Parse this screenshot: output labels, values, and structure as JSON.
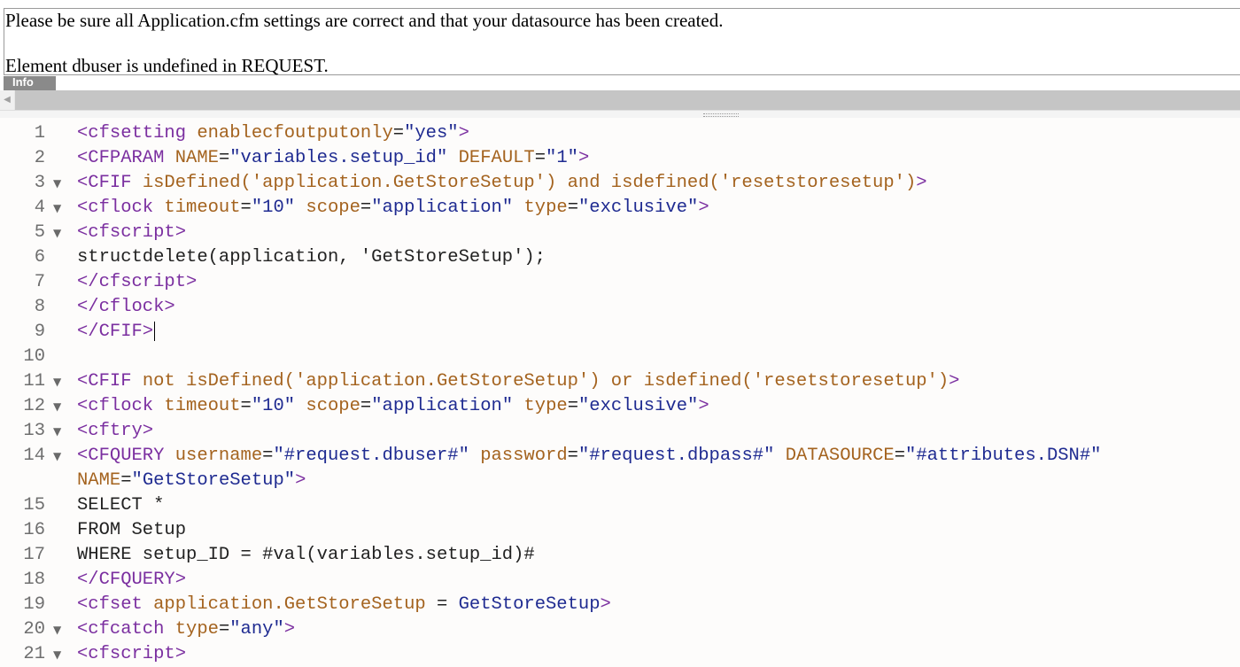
{
  "error": {
    "line1": "Please be sure all Application.cfm settings are correct and that your datasource has been created.",
    "line2": "Element dbuser is undefined in REQUEST."
  },
  "tab_stub": "Info",
  "scrollbar": {
    "left_arrow": "◀"
  },
  "editor": {
    "lines": [
      {
        "num": "1",
        "fold": false,
        "tokens": [
          [
            "tag",
            "<cfsetting "
          ],
          [
            "attr",
            "enablecfoutputonly"
          ],
          [
            "plain",
            "="
          ],
          [
            "str",
            "\"yes\""
          ],
          [
            "tag",
            ">"
          ]
        ]
      },
      {
        "num": "2",
        "fold": false,
        "tokens": [
          [
            "tag",
            "<CFPARAM "
          ],
          [
            "attr",
            "NAME"
          ],
          [
            "plain",
            "="
          ],
          [
            "str",
            "\"variables.setup_id\""
          ],
          [
            "plain",
            " "
          ],
          [
            "attr",
            "DEFAULT"
          ],
          [
            "plain",
            "="
          ],
          [
            "str",
            "\"1\""
          ],
          [
            "tag",
            ">"
          ]
        ]
      },
      {
        "num": "3",
        "fold": true,
        "tokens": [
          [
            "tag",
            "<CFIF "
          ],
          [
            "attr",
            "isDefined('application.GetStoreSetup') and isdefined('resetstoresetup')"
          ],
          [
            "tag",
            ">"
          ]
        ]
      },
      {
        "num": "4",
        "fold": true,
        "tokens": [
          [
            "tag",
            "<cflock "
          ],
          [
            "attr",
            "timeout"
          ],
          [
            "plain",
            "="
          ],
          [
            "str",
            "\"10\""
          ],
          [
            "plain",
            " "
          ],
          [
            "attr",
            "scope"
          ],
          [
            "plain",
            "="
          ],
          [
            "str",
            "\"application\""
          ],
          [
            "plain",
            " "
          ],
          [
            "attr",
            "type"
          ],
          [
            "plain",
            "="
          ],
          [
            "str",
            "\"exclusive\""
          ],
          [
            "tag",
            ">"
          ]
        ]
      },
      {
        "num": "5",
        "fold": true,
        "tokens": [
          [
            "tag",
            "<cfscript>"
          ]
        ]
      },
      {
        "num": "6",
        "fold": false,
        "tokens": [
          [
            "plain",
            "structdelete(application, 'GetStoreSetup');"
          ]
        ]
      },
      {
        "num": "7",
        "fold": false,
        "tokens": [
          [
            "tag",
            "</cfscript>"
          ]
        ]
      },
      {
        "num": "8",
        "fold": false,
        "tokens": [
          [
            "tag",
            "</cflock>"
          ]
        ]
      },
      {
        "num": "9",
        "fold": false,
        "caret": true,
        "tokens": [
          [
            "tag",
            "</CFIF>"
          ]
        ]
      },
      {
        "num": "10",
        "fold": false,
        "tokens": []
      },
      {
        "num": "11",
        "fold": true,
        "tokens": [
          [
            "tag",
            "<CFIF "
          ],
          [
            "attr",
            "not isDefined('application.GetStoreSetup') or isdefined('resetstoresetup')"
          ],
          [
            "tag",
            ">"
          ]
        ]
      },
      {
        "num": "12",
        "fold": true,
        "tokens": [
          [
            "tag",
            "<cflock "
          ],
          [
            "attr",
            "timeout"
          ],
          [
            "plain",
            "="
          ],
          [
            "str",
            "\"10\""
          ],
          [
            "plain",
            " "
          ],
          [
            "attr",
            "scope"
          ],
          [
            "plain",
            "="
          ],
          [
            "str",
            "\"application\""
          ],
          [
            "plain",
            " "
          ],
          [
            "attr",
            "type"
          ],
          [
            "plain",
            "="
          ],
          [
            "str",
            "\"exclusive\""
          ],
          [
            "tag",
            ">"
          ]
        ]
      },
      {
        "num": "13",
        "fold": true,
        "tokens": [
          [
            "tag",
            "<cftry>"
          ]
        ]
      },
      {
        "num": "14",
        "fold": true,
        "tokens": [
          [
            "tag",
            "<CFQUERY "
          ],
          [
            "attr",
            "username"
          ],
          [
            "plain",
            "="
          ],
          [
            "str",
            "\"#request.dbuser#\""
          ],
          [
            "plain",
            " "
          ],
          [
            "attr",
            "password"
          ],
          [
            "plain",
            "="
          ],
          [
            "str",
            "\"#request.dbpass#\""
          ],
          [
            "plain",
            " "
          ],
          [
            "attr",
            "DATASOURCE"
          ],
          [
            "plain",
            "="
          ],
          [
            "str",
            "\"#attributes.DSN#\""
          ]
        ]
      },
      {
        "num": "",
        "fold": false,
        "tokens": [
          [
            "attr",
            "NAME"
          ],
          [
            "plain",
            "="
          ],
          [
            "str",
            "\"GetStoreSetup\""
          ],
          [
            "tag",
            ">"
          ]
        ]
      },
      {
        "num": "15",
        "fold": false,
        "tokens": [
          [
            "plain",
            "SELECT *"
          ]
        ]
      },
      {
        "num": "16",
        "fold": false,
        "tokens": [
          [
            "plain",
            "FROM Setup"
          ]
        ]
      },
      {
        "num": "17",
        "fold": false,
        "tokens": [
          [
            "plain",
            "WHERE setup_ID = #val(variables.setup_id)#"
          ]
        ]
      },
      {
        "num": "18",
        "fold": false,
        "tokens": [
          [
            "tag",
            "</CFQUERY>"
          ]
        ]
      },
      {
        "num": "19",
        "fold": false,
        "tokens": [
          [
            "tag",
            "<cfset "
          ],
          [
            "attr",
            "application.GetStoreSetup"
          ],
          [
            "plain",
            " = "
          ],
          [
            "str",
            "GetStoreSetup"
          ],
          [
            "tag",
            ">"
          ]
        ]
      },
      {
        "num": "20",
        "fold": true,
        "tokens": [
          [
            "tag",
            "<cfcatch "
          ],
          [
            "attr",
            "type"
          ],
          [
            "plain",
            "="
          ],
          [
            "str",
            "\"any\""
          ],
          [
            "tag",
            ">"
          ]
        ]
      },
      {
        "num": "21",
        "fold": true,
        "tokens": [
          [
            "tag",
            "<cfscript>"
          ]
        ]
      }
    ]
  },
  "colors": {
    "tag": "#7b2fa0",
    "attr": "#a4631f",
    "string": "#1f2b91",
    "plain": "#222222",
    "line_number": "#6f6f6f"
  },
  "icons": {
    "fold": "fold-triangle-icon"
  }
}
